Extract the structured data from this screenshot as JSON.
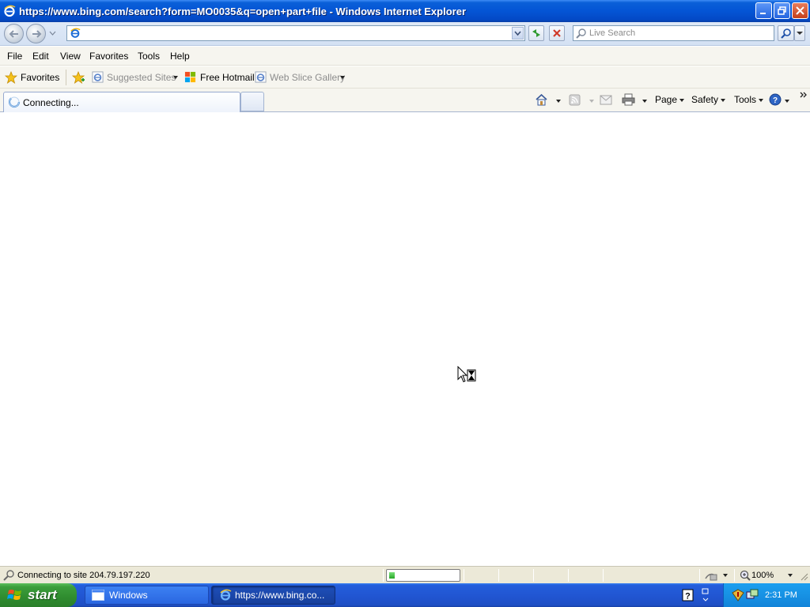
{
  "window": {
    "title": "https://www.bing.com/search?form=MO0035&q=open+part+file - Windows Internet Explorer"
  },
  "address_bar": {
    "value": ""
  },
  "search": {
    "placeholder": "Live Search"
  },
  "menu": {
    "items": [
      "File",
      "Edit",
      "View",
      "Favorites",
      "Tools",
      "Help"
    ]
  },
  "favorites_bar": {
    "favorites_label": "Favorites",
    "items": [
      "Suggested Sites",
      "Free Hotmail",
      "Web Slice Gallery"
    ]
  },
  "tab": {
    "label": "Connecting..."
  },
  "command_bar": {
    "page": "Page",
    "safety": "Safety",
    "tools": "Tools"
  },
  "status_bar": {
    "text": "Connecting to site 204.79.197.220",
    "progress": 0.08,
    "zoom": "100%"
  },
  "taskbar": {
    "start_label": "start",
    "items": [
      "Windows",
      "https://www.bing.co..."
    ],
    "clock": "2:31 PM"
  },
  "colors": {
    "titlebar": "#0455d5",
    "taskbar": "#245edb",
    "start_button": "#3c9e3c",
    "progress_fill": "#26a626"
  }
}
